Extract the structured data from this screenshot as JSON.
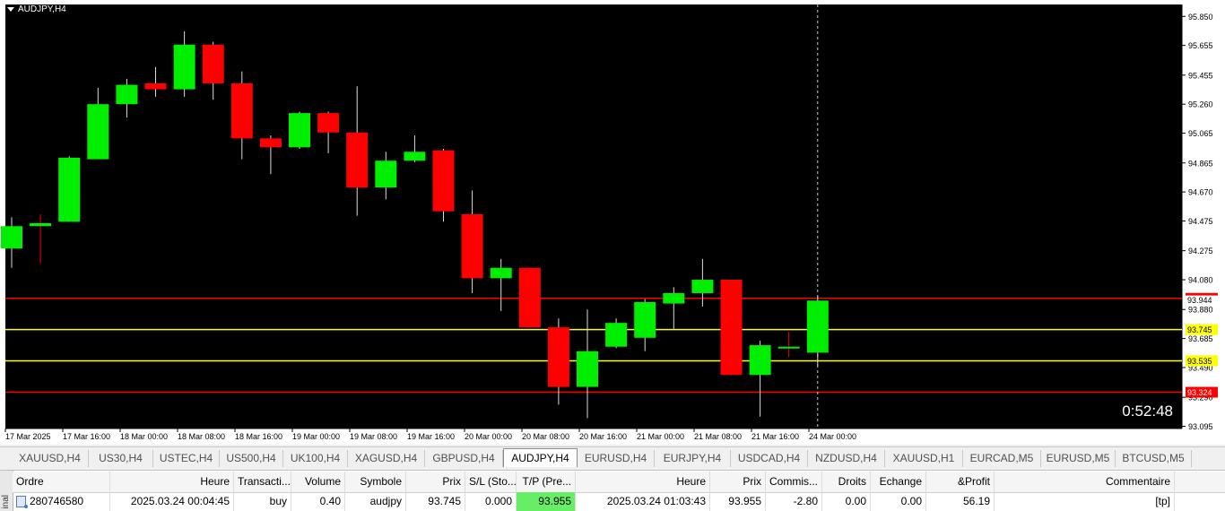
{
  "chart": {
    "symbol": "AUDJPY,H4",
    "countdown": "0:52:48",
    "colors": {
      "background": "#000000",
      "bull": "#00ee00",
      "bear": "#ff0000",
      "wick": "#ffffff",
      "sl_line": "#ff0000",
      "tp_line": "#ff0000",
      "entry_line": "#ffff00"
    },
    "y_axis": {
      "range": [
        93.08,
        95.93
      ],
      "ticks": [
        "95.850",
        "95.655",
        "95.455",
        "95.260",
        "95.065",
        "94.865",
        "94.670",
        "94.475",
        "94.275",
        "94.080",
        "93.880",
        "93.685",
        "93.490",
        "93.290",
        "93.095"
      ]
    },
    "x_axis": {
      "ticks": [
        "17 Mar 2025",
        "17 Mar 16:00",
        "18 Mar 00:00",
        "18 Mar 08:00",
        "18 Mar 16:00",
        "19 Mar 00:00",
        "19 Mar 08:00",
        "19 Mar 16:00",
        "20 Mar 00:00",
        "20 Mar 08:00",
        "20 Mar 16:00",
        "21 Mar 00:00",
        "21 Mar 08:00",
        "21 Mar 16:00",
        "24 Mar 00:00"
      ]
    },
    "levels": [
      {
        "price": 93.955,
        "label": "93.955",
        "kind": "tp"
      },
      {
        "price": 93.745,
        "label": "93.745",
        "kind": "entry"
      },
      {
        "price": 93.535,
        "label": "93.535",
        "kind": "entry"
      },
      {
        "price": 93.324,
        "label": "93.324",
        "kind": "sl"
      }
    ],
    "bid_label": "93.944"
  },
  "chart_data": {
    "type": "candlestick",
    "title": "AUDJPY,H4",
    "ylim": [
      93.08,
      95.93
    ],
    "series": [
      {
        "o": 94.29,
        "h": 94.5,
        "l": 94.16,
        "c": 94.44
      },
      {
        "o": 94.44,
        "h": 94.52,
        "l": 94.19,
        "c": 94.46
      },
      {
        "o": 94.47,
        "h": 94.91,
        "l": 94.47,
        "c": 94.9
      },
      {
        "o": 94.89,
        "h": 95.37,
        "l": 94.89,
        "c": 95.26
      },
      {
        "o": 95.26,
        "h": 95.43,
        "l": 95.17,
        "c": 95.39
      },
      {
        "o": 95.4,
        "h": 95.51,
        "l": 95.31,
        "c": 95.36
      },
      {
        "o": 95.36,
        "h": 95.75,
        "l": 95.31,
        "c": 95.66
      },
      {
        "o": 95.66,
        "h": 95.68,
        "l": 95.29,
        "c": 95.4
      },
      {
        "o": 95.4,
        "h": 95.48,
        "l": 94.89,
        "c": 95.03
      },
      {
        "o": 95.03,
        "h": 95.05,
        "l": 94.79,
        "c": 94.97
      },
      {
        "o": 94.97,
        "h": 95.21,
        "l": 94.96,
        "c": 95.2
      },
      {
        "o": 95.2,
        "h": 95.21,
        "l": 94.93,
        "c": 95.07
      },
      {
        "o": 95.07,
        "h": 95.38,
        "l": 94.51,
        "c": 94.7
      },
      {
        "o": 94.7,
        "h": 94.94,
        "l": 94.62,
        "c": 94.88
      },
      {
        "o": 94.88,
        "h": 95.05,
        "l": 94.87,
        "c": 94.94
      },
      {
        "o": 94.95,
        "h": 94.96,
        "l": 94.47,
        "c": 94.54
      },
      {
        "o": 94.52,
        "h": 94.68,
        "l": 93.99,
        "c": 94.09
      },
      {
        "o": 94.09,
        "h": 94.22,
        "l": 93.87,
        "c": 94.16
      },
      {
        "o": 94.16,
        "h": 94.16,
        "l": 93.76,
        "c": 93.76
      },
      {
        "o": 93.76,
        "h": 93.82,
        "l": 93.24,
        "c": 93.36
      },
      {
        "o": 93.36,
        "h": 93.88,
        "l": 93.15,
        "c": 93.6
      },
      {
        "o": 93.63,
        "h": 93.82,
        "l": 93.62,
        "c": 93.79
      },
      {
        "o": 93.69,
        "h": 93.95,
        "l": 93.6,
        "c": 93.93
      },
      {
        "o": 93.92,
        "h": 94.03,
        "l": 93.75,
        "c": 93.99
      },
      {
        "o": 93.99,
        "h": 94.22,
        "l": 93.9,
        "c": 94.08
      },
      {
        "o": 94.08,
        "h": 94.08,
        "l": 93.44,
        "c": 93.44
      },
      {
        "o": 93.44,
        "h": 93.67,
        "l": 93.16,
        "c": 93.64
      },
      {
        "o": 93.63,
        "h": 93.73,
        "l": 93.56,
        "c": 93.63
      },
      {
        "o": 93.59,
        "h": 93.97,
        "l": 93.5,
        "c": 93.94
      }
    ]
  },
  "tabs": [
    "XAUUSD,H4",
    "US30,H4",
    "USTEC,H4",
    "US500,H4",
    "UK100,H4",
    "XAGUSD,H4",
    "GBPUSD,H4",
    "AUDJPY,H4",
    "EURUSD,H4",
    "EURJPY,H4",
    "USDCAD,H4",
    "NZDUSD,H4",
    "XAUUSD,H1",
    "EURCAD,M5",
    "EURUSD,M5",
    "BTCUSD,M5"
  ],
  "active_tab": "AUDJPY,H4",
  "terminal": {
    "side_label": "inal",
    "headers": [
      "Ordre",
      "Heure",
      "Transacti...",
      "Volume",
      "Symbole",
      "Prix",
      "S/L (Sto...",
      "T/P (Pre...",
      "Heure",
      "Prix",
      "Commis...",
      "Droits",
      "Echange",
      "&Profit",
      "Commentaire"
    ],
    "row": [
      "280746580",
      "2025.03.24 00:04:45",
      "buy",
      "0.40",
      "audjpy",
      "93.745",
      "0.000",
      "93.955",
      "2025.03.24 01:03:43",
      "93.955",
      "-2.80",
      "0.00",
      "0.00",
      "56.19",
      "[tp]"
    ]
  }
}
